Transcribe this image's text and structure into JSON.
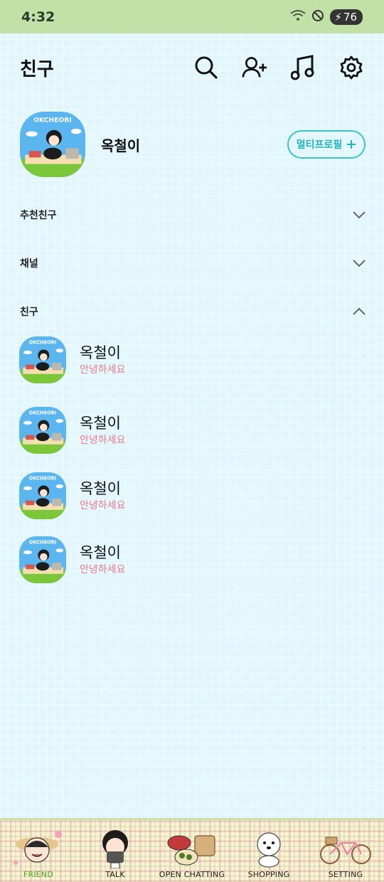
{
  "status_bar": {
    "time": "4:32",
    "battery": "76"
  },
  "header": {
    "title": "친구"
  },
  "my_profile": {
    "name": "옥철이",
    "multi_profile_label": "멀티프로필",
    "avatar_text": "OKCHEORI"
  },
  "sections": {
    "recommended": "추천친구",
    "channels": "채널",
    "friends": "친구"
  },
  "friends": [
    {
      "name": "옥철이",
      "status": "안녕하세요"
    },
    {
      "name": "옥철이",
      "status": "안녕하세요"
    },
    {
      "name": "옥철이",
      "status": "안녕하세요"
    },
    {
      "name": "옥철이",
      "status": "안녕하세요"
    }
  ],
  "nav": [
    {
      "label": "FRIEND",
      "active": true
    },
    {
      "label": "TALK"
    },
    {
      "label": "OPEN CHATTING"
    },
    {
      "label": "SHOPPING"
    },
    {
      "label": "SETTING"
    }
  ]
}
